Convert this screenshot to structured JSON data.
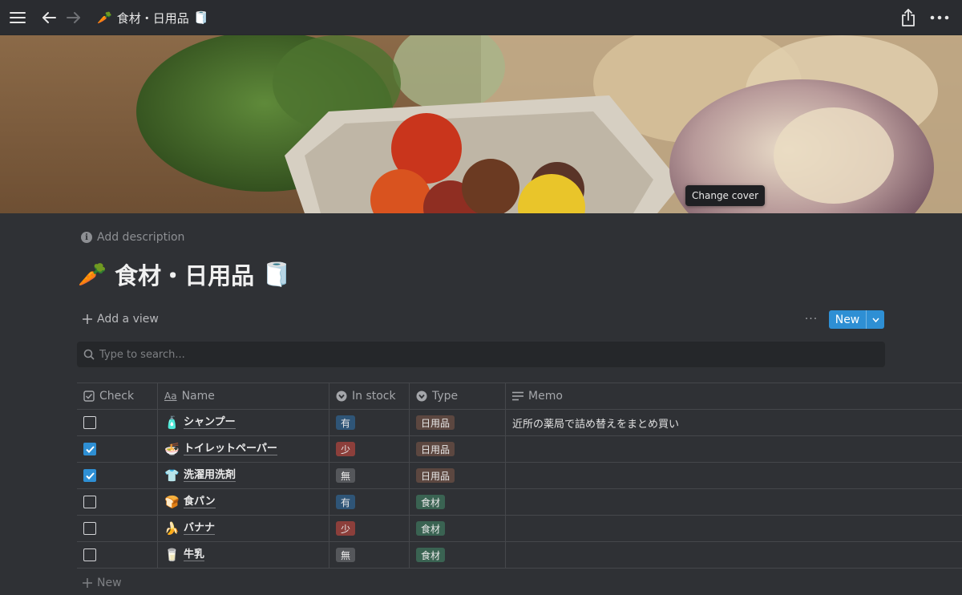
{
  "topbar": {
    "title_emoji": "🥕",
    "title": "食材・日用品",
    "title_emoji_end": "🧻"
  },
  "cover": {
    "change_cover_label": "Change cover"
  },
  "page": {
    "add_description": "Add description",
    "title_emoji": "🥕",
    "title": "食材・日用品",
    "title_emoji_end": "🧻"
  },
  "toolbar": {
    "add_view": "Add a view",
    "more": "···",
    "new_label": "New"
  },
  "search": {
    "placeholder": "Type to search..."
  },
  "table": {
    "columns": [
      {
        "label": "Check",
        "icon": "checkbox-icon"
      },
      {
        "label": "Name",
        "icon": "text-aa-icon"
      },
      {
        "label": "In stock",
        "icon": "select-icon"
      },
      {
        "label": "Type",
        "icon": "select-icon"
      },
      {
        "label": "Memo",
        "icon": "text-lines-icon"
      }
    ],
    "rows": [
      {
        "checked": false,
        "emoji": "🧴",
        "name": "シャンプー",
        "stock": "有",
        "type": "日用品",
        "memo": "近所の薬局で詰め替えをまとめ買い"
      },
      {
        "checked": true,
        "emoji": "🍜",
        "name": "トイレットペーパー",
        "stock": "少",
        "type": "日用品",
        "memo": ""
      },
      {
        "checked": true,
        "emoji": "👕",
        "name": "洗濯用洗剤",
        "stock": "無",
        "type": "日用品",
        "memo": ""
      },
      {
        "checked": false,
        "emoji": "🍞",
        "name": "食パン",
        "stock": "有",
        "type": "食材",
        "memo": ""
      },
      {
        "checked": false,
        "emoji": "🍌",
        "name": "バナナ",
        "stock": "少",
        "type": "食材",
        "memo": ""
      },
      {
        "checked": false,
        "emoji": "🥛",
        "name": "牛乳",
        "stock": "無",
        "type": "食材",
        "memo": ""
      }
    ],
    "add_new": "New"
  },
  "colors": {
    "accent": "#2e8fd4",
    "tag_stock_have": "#2f5577",
    "tag_stock_low": "#8c3f3b",
    "tag_stock_none": "#55575b",
    "tag_type_daily": "#5c4740",
    "tag_type_food": "#3a6352"
  }
}
